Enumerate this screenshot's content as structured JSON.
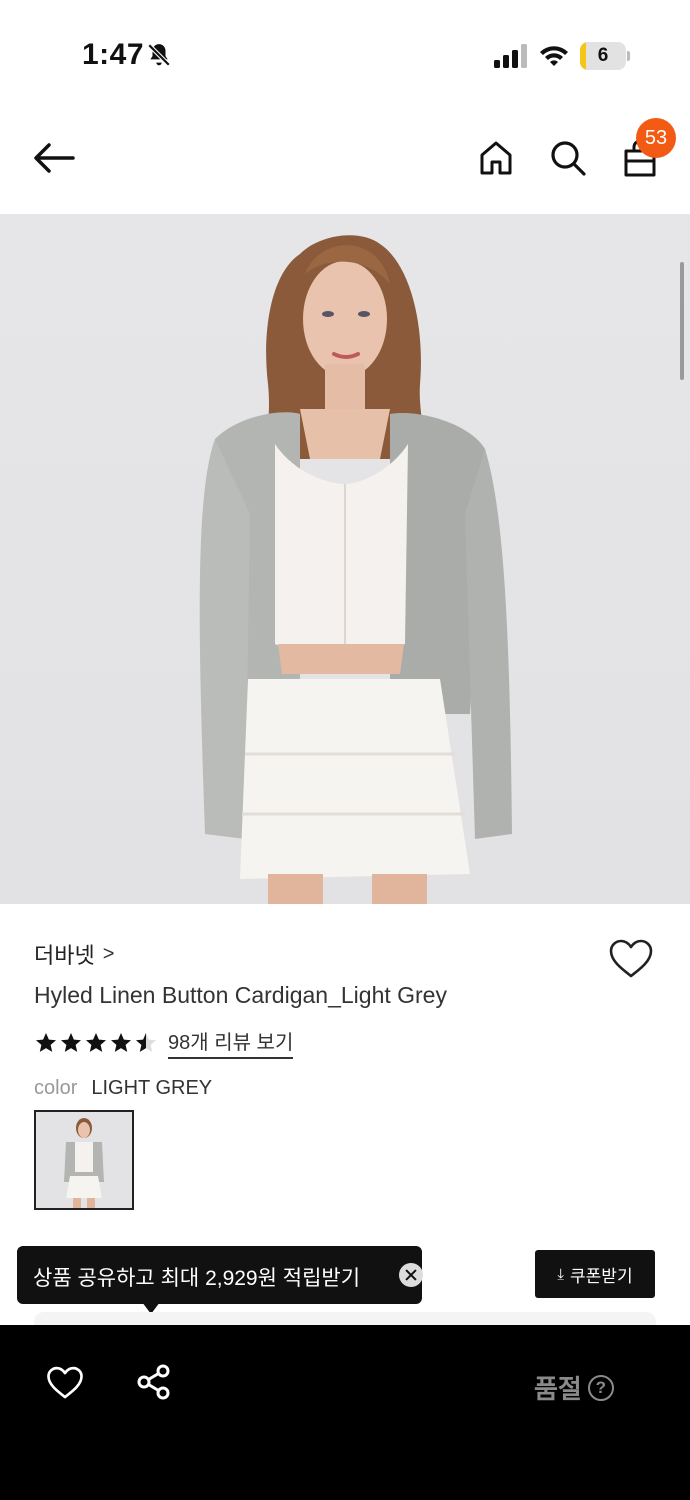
{
  "status_bar": {
    "time": "1:47",
    "battery_level": "6",
    "battery_percent": 6
  },
  "header": {
    "cart_count": "53"
  },
  "product": {
    "brand": "더바넷",
    "brand_chevron": ">",
    "title": "Hyled Linen Button Cardigan_Light Grey",
    "rating": 4.5,
    "reviews_label": "98개 리뷰 보기",
    "color_label": "color",
    "color_value": "LIGHT GREY"
  },
  "promo": {
    "tooltip_text": "상품 공유하고 최대 2,929원 적립받기",
    "coupon_label": "쿠폰받기",
    "coupon_icon": "⤓"
  },
  "bottom_bar": {
    "status_label": "품절",
    "help_glyph": "?"
  },
  "icons": [
    "bell-slash-icon",
    "cellular-signal-icon",
    "wifi-icon",
    "battery-icon",
    "back-arrow-icon",
    "home-icon",
    "search-icon",
    "shopping-bag-icon",
    "heart-icon",
    "star-icon",
    "download-icon",
    "close-icon",
    "share-icon",
    "help-icon"
  ],
  "colors": {
    "accent": "#f35a14",
    "bottom_bar": "#000000",
    "tooltip": "#111111",
    "disabled_text": "#8a8a8a"
  }
}
